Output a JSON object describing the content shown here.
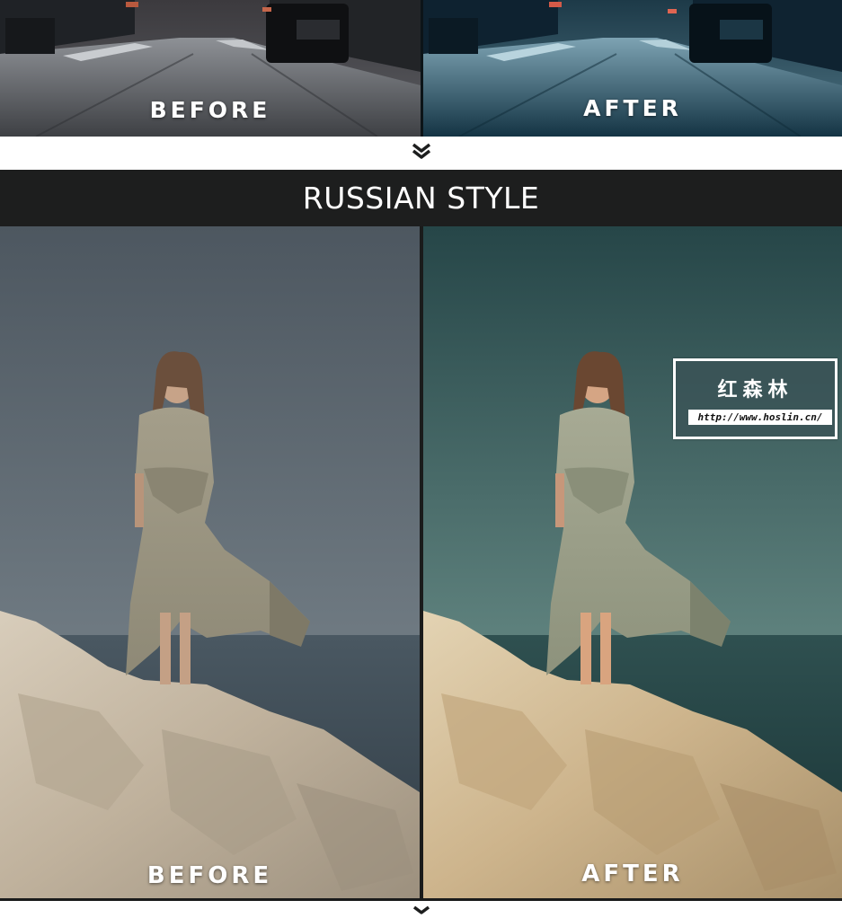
{
  "top_comparison": {
    "before_label": "BEFORE",
    "after_label": "AFTER"
  },
  "banner": {
    "title": "RUSSIAN STYLE"
  },
  "main_comparison": {
    "before_label": "BEFORE",
    "after_label": "AFTER"
  },
  "watermark": {
    "title": "红森林",
    "url": "http://www.hoslin.cn/"
  },
  "icons": {
    "divider": "double-chevron-down-icon"
  },
  "colors": {
    "banner_bg": "#1d1e1e",
    "divider": "#1a1b1b",
    "label_text": "#ffffff"
  }
}
